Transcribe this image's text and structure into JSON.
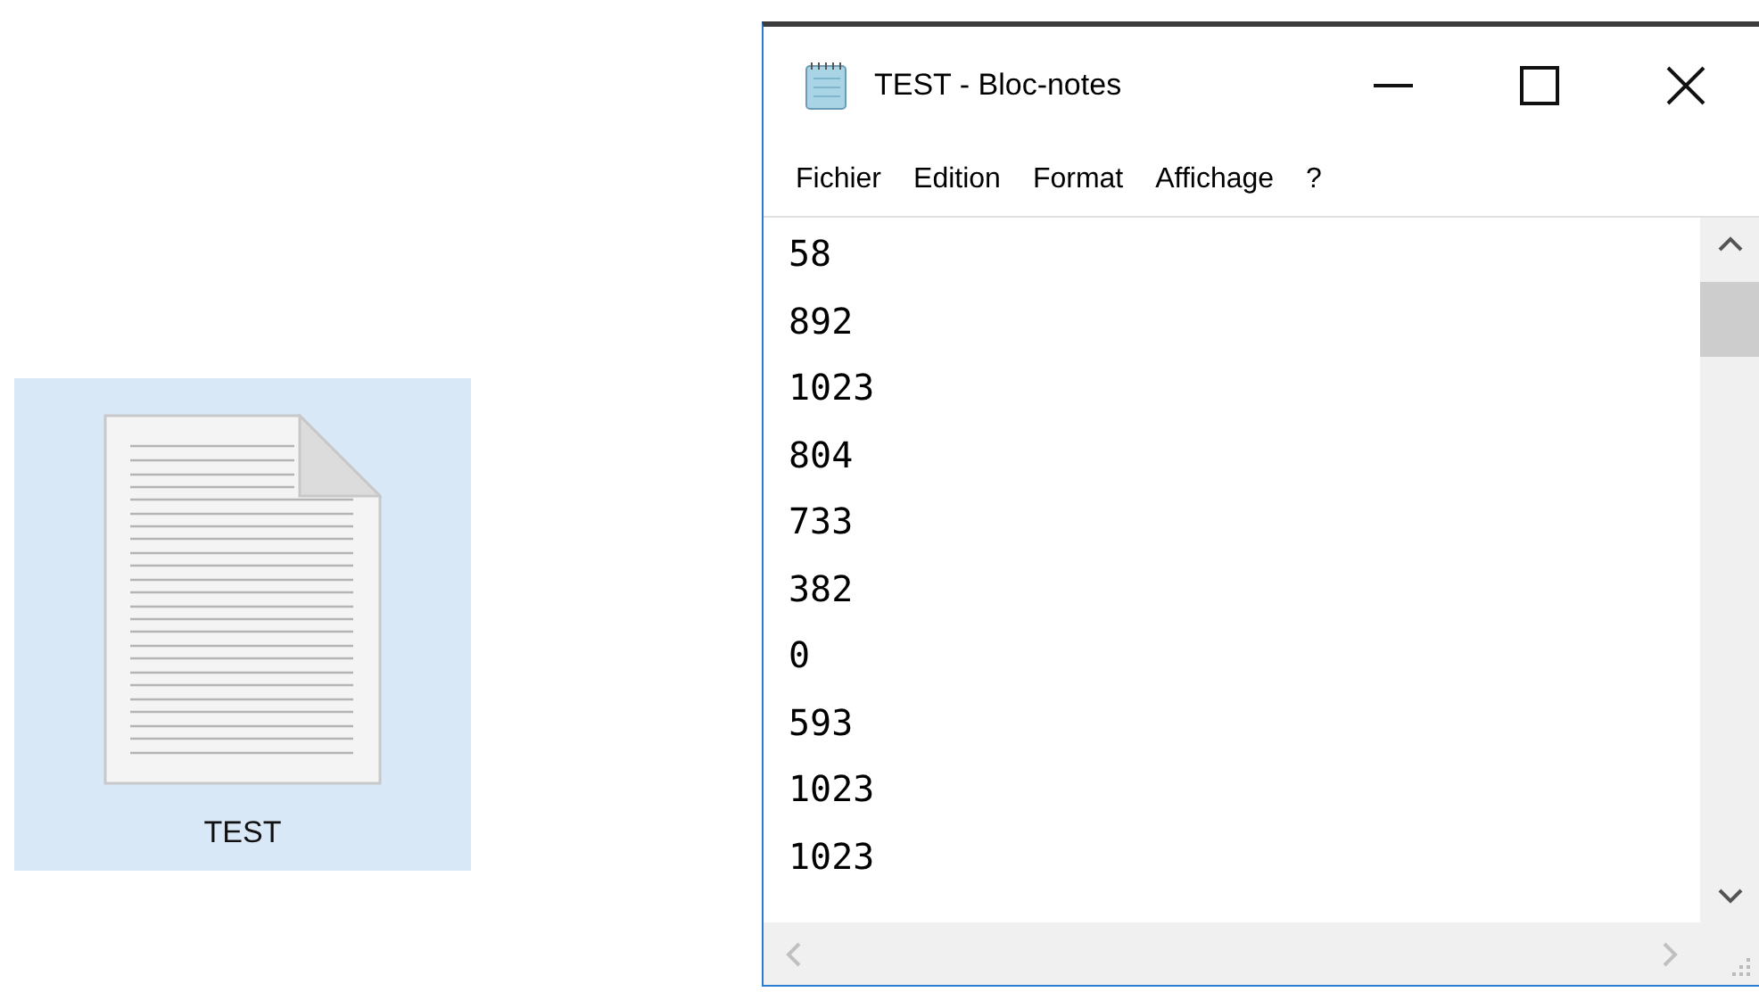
{
  "desktop_icon": {
    "label": "TEST",
    "selected": true
  },
  "window": {
    "title": "TEST - Bloc-notes",
    "menu": [
      "Fichier",
      "Edition",
      "Format",
      "Affichage",
      "?"
    ],
    "lines": [
      "58",
      "892",
      "1023",
      "804",
      "733",
      "382",
      "0",
      "593",
      "1023",
      "1023"
    ]
  }
}
